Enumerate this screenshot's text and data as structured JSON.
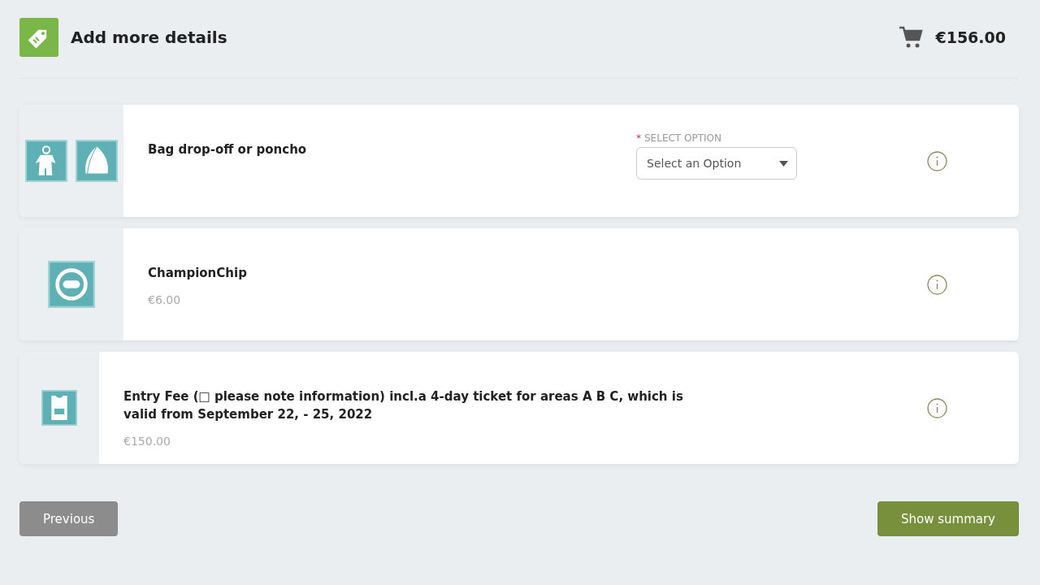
{
  "header": {
    "title": "Add more details",
    "cart_total": "€156.00"
  },
  "items": [
    {
      "kind": "select",
      "name": "Bag drop-off or poncho",
      "select": {
        "required_mark": "*",
        "label": "SELECT OPTION",
        "placeholder": "Select an Option"
      }
    },
    {
      "kind": "priced",
      "name": "ChampionChip",
      "price": "€6.00"
    },
    {
      "kind": "priced",
      "name": "Entry Fee (□ please note information) incl.a 4-day ticket for areas A B C, which is valid from September 22, - 25, 2022",
      "price": "€150.00"
    }
  ],
  "buttons": {
    "previous": "Previous",
    "next": "Show summary"
  }
}
